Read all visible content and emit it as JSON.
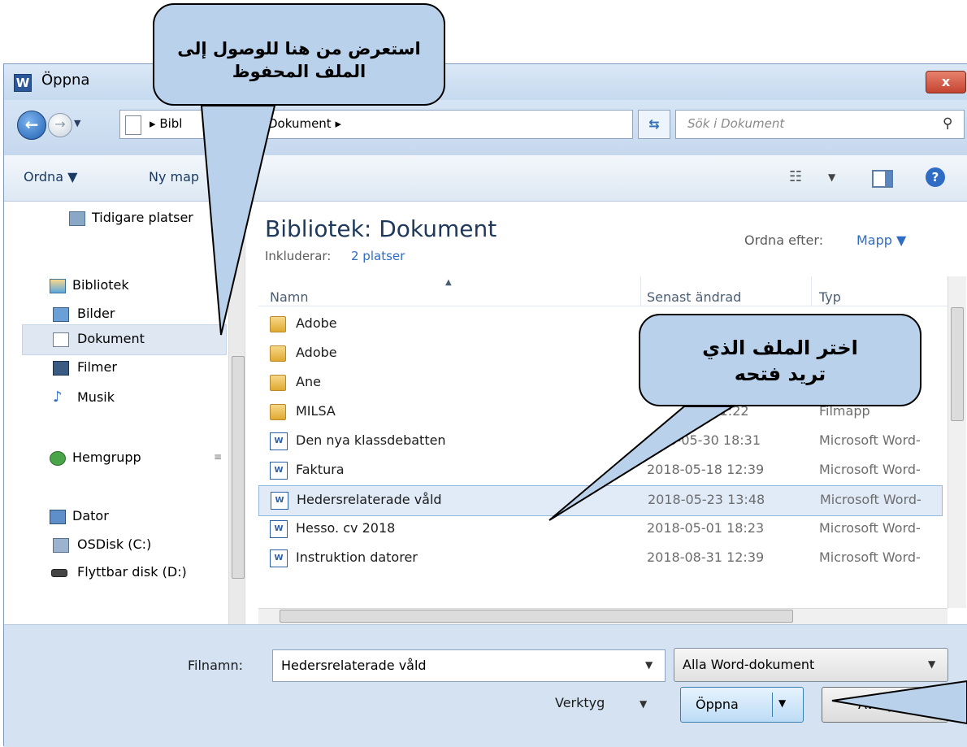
{
  "window": {
    "title": "Öppna",
    "app_icon": "W",
    "close_label": "x"
  },
  "nav": {
    "breadcrumb_first": "Bibl",
    "breadcrumb_second": "Dokument",
    "search_placeholder": "Sök i Dokument"
  },
  "toolbar": {
    "organize_label": "Ordna ▼",
    "new_folder_label": "Ny map"
  },
  "sidebar": {
    "items": [
      {
        "label": "Tidigare platser"
      },
      {
        "label": "Bibliotek"
      },
      {
        "label": "Bilder"
      },
      {
        "label": "Dokument"
      },
      {
        "label": "Filmer"
      },
      {
        "label": "Musik"
      },
      {
        "label": "Hemgrupp"
      },
      {
        "label": "Dator"
      },
      {
        "label": "OSDisk (C:)"
      },
      {
        "label": "Flyttbar disk (D:)"
      }
    ]
  },
  "library": {
    "title": "Bibliotek: Dokument",
    "includes_label": "Inkluderar:",
    "includes_link": "2 platser",
    "sort_label": "Ordna efter:",
    "sort_value": "Mapp"
  },
  "table": {
    "headers": [
      "Namn",
      "Senast ändrad",
      "Typ"
    ],
    "rows": [
      {
        "name": "Adobe",
        "date": "",
        "type": "",
        "kind": "folder"
      },
      {
        "name": "Adobe",
        "date": "",
        "type": "",
        "kind": "folder"
      },
      {
        "name": "Ane",
        "date": "",
        "type": "",
        "kind": "folder"
      },
      {
        "name": "MILSA",
        "date": "16 11:22",
        "type": "Filmapp",
        "kind": "folder"
      },
      {
        "name": "Den nya klassdebatten",
        "date": "018-05-30 18:31",
        "type": "Microsoft Word-",
        "kind": "doc"
      },
      {
        "name": "Faktura",
        "date": "2018-05-18 12:39",
        "type": "Microsoft Word-",
        "kind": "doc"
      },
      {
        "name": "Hedersrelaterade våld",
        "date": "2018-05-23 13:48",
        "type": "Microsoft Word-",
        "kind": "doc",
        "selected": true
      },
      {
        "name": "Hesso. cv  2018",
        "date": "2018-05-01 18:23",
        "type": "Microsoft Word-",
        "kind": "doc"
      },
      {
        "name": "Instruktion datorer",
        "date": "2018-08-31 12:39",
        "type": "Microsoft Word-",
        "kind": "doc"
      }
    ]
  },
  "footer": {
    "filename_label": "Filnamn:",
    "filename_value": "Hedersrelaterade våld",
    "filetype_value": "Alla Word-dokument",
    "tools_label": "Verktyg",
    "open_label": "Öppna",
    "cancel_label": "Avbryt"
  },
  "callouts": {
    "browse": "استعرض من هنا للوصول إلى الملف المحفوظ",
    "choose": "اختر الملف الذي تريد فتحه"
  },
  "colors": {
    "callout_fill": "#b9d1ea",
    "selection": "#e0ebf7",
    "link": "#2f6cc4"
  }
}
